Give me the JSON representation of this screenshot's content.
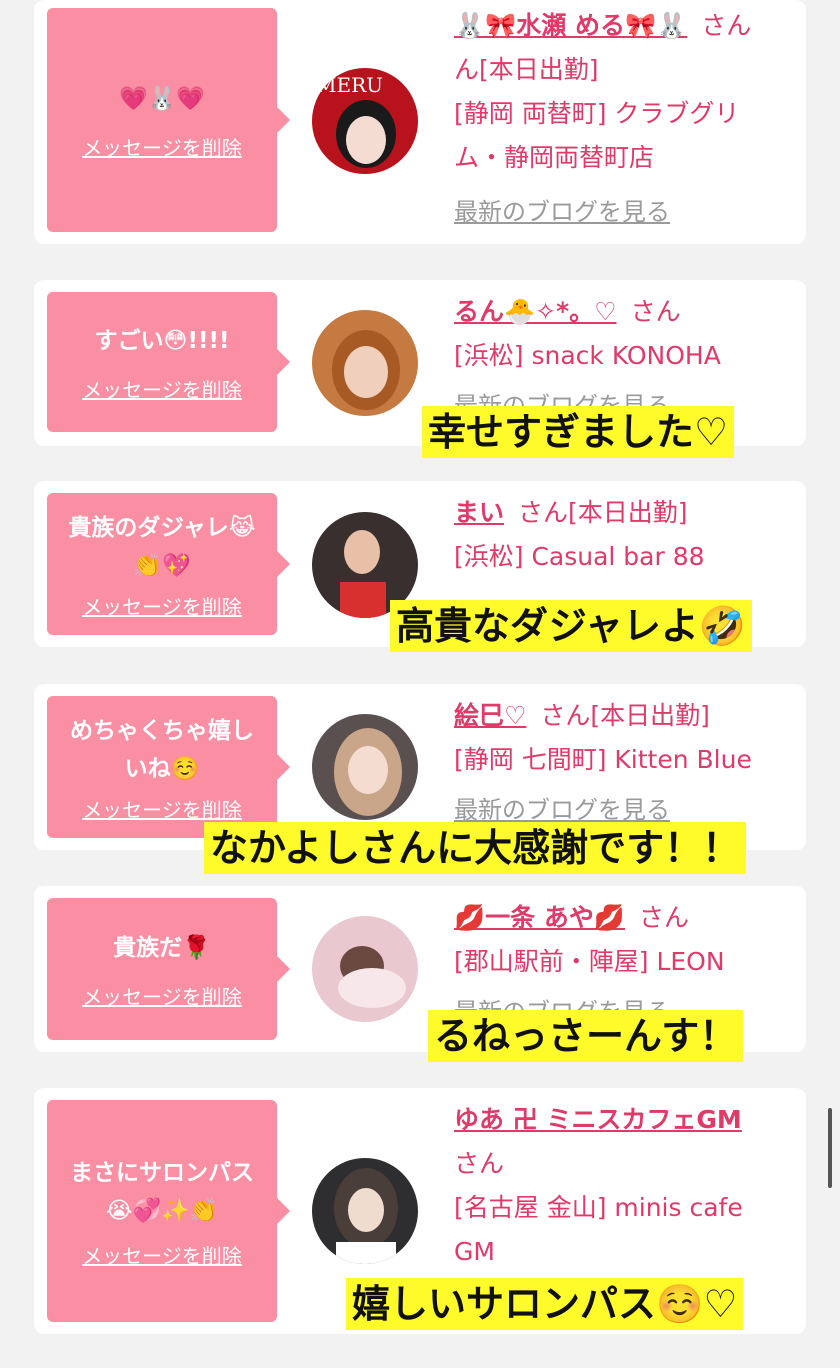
{
  "cards": [
    {
      "message": "💗🐰💗",
      "delete_label": "メッセージを削除",
      "name": "🐰🎀水瀬 める🎀🐰",
      "suffix": "さん",
      "status_line": "ん[本日出勤]",
      "shop": "[静岡 両替町] クラブグリム・静岡両替町店",
      "blog_label": "最新のブログを見る",
      "avatar_icon": "woman-photo-icon",
      "colors": {
        "avatar_bg": "#b8131c"
      }
    },
    {
      "message": "すごい😳!!!!",
      "delete_label": "メッセージを削除",
      "name": "るん🐣✧*。♡",
      "suffix": "さん",
      "shop": "[浜松] snack KONOHA",
      "blog_label": "最新のブログを見る",
      "caption": "幸せすぎました♡",
      "avatar_icon": "woman-photo-icon",
      "colors": {
        "avatar_bg": "#c47a40"
      }
    },
    {
      "message_line1": "貴族のダジャレ😹",
      "message_line2": "👏💖",
      "delete_label": "メッセージを削除",
      "name": "まい",
      "suffix": "さん[本日出勤]",
      "shop": "[浜松] Casual bar 88",
      "caption": "高貴なダジャレよ🤣",
      "avatar_icon": "woman-photo-icon",
      "colors": {
        "avatar_bg": "#3a2f2f"
      }
    },
    {
      "message_line1": "めちゃくちゃ嬉し",
      "message_line2": "いね☺️",
      "delete_label": "メッセージを削除",
      "name": "絵巳♡",
      "suffix": "さん[本日出勤]",
      "shop": "[静岡 七間町] Kitten Blue",
      "blog_label": "最新のブログを見る",
      "caption": "なかよしさんに大感謝です！！",
      "avatar_icon": "woman-photo-icon",
      "colors": {
        "avatar_bg": "#5a5050"
      }
    },
    {
      "message": "貴族だ🌹",
      "delete_label": "メッセージを削除",
      "name": "💋一条 あや💋",
      "suffix": "さん",
      "shop": "[郡山駅前・陣屋] LEON",
      "blog_label": "最新のブログを見る",
      "caption": "るねっさーんす！",
      "avatar_icon": "woman-photo-icon",
      "colors": {
        "avatar_bg": "#e9c8cf"
      }
    },
    {
      "message_line1": "まさにサロンパス",
      "message_line2": "😭💞✨👏",
      "delete_label": "メッセージを削除",
      "name": "ゆあ 卍 ミニスカフェGM",
      "suffix": "さん",
      "shop": "[名古屋 金山] minis cafe GM",
      "caption": "嬉しいサロンパス☺️♡",
      "avatar_icon": "woman-photo-icon",
      "colors": {
        "avatar_bg": "#2e2e30"
      }
    }
  ]
}
